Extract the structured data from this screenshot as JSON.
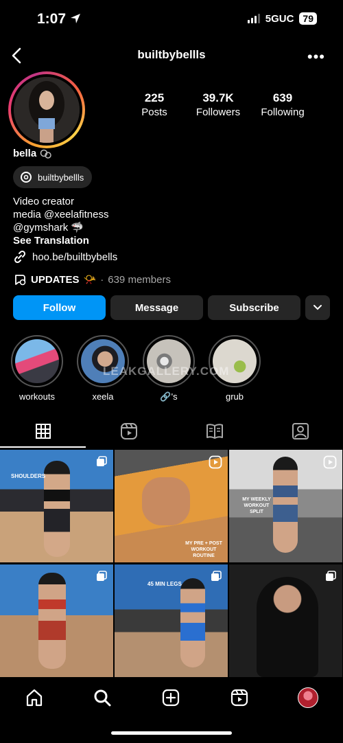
{
  "status_bar": {
    "time": "1:07",
    "network": "5GUC",
    "battery": "79"
  },
  "header": {
    "username": "builtbybellls"
  },
  "profile": {
    "stats": [
      {
        "value": "225",
        "label": "Posts"
      },
      {
        "value": "39.7K",
        "label": "Followers"
      },
      {
        "value": "639",
        "label": "Following"
      }
    ],
    "display_name": "bella",
    "threads_handle": "builtbybellls",
    "bio_lines": [
      "Video creator",
      "media @xeelafitness",
      "@gymshark 🦈"
    ],
    "see_translation": "See Translation",
    "link": "hoo.be/builtbybells",
    "channel": {
      "name": "UPDATES",
      "emoji": "📯",
      "separator": "·",
      "members": "639 members"
    }
  },
  "buttons": {
    "follow": "Follow",
    "message": "Message",
    "subscribe": "Subscribe"
  },
  "highlights": [
    {
      "label": "workouts"
    },
    {
      "label": "xeela"
    },
    {
      "label": "🔗's"
    },
    {
      "label": "grub"
    }
  ],
  "watermark": "LEAKGALLERY.COM",
  "posts": [
    {
      "overlay": "SHOULDERS",
      "type": "carousel"
    },
    {
      "overlay": "MY PRE + POST WORKOUT ROUTINE",
      "type": "reel"
    },
    {
      "overlay": "MY WEEKLY WORKOUT SPLIT",
      "type": "reel"
    },
    {
      "overlay": "",
      "type": "carousel"
    },
    {
      "overlay": "45 MIN LEGS",
      "type": "carousel"
    },
    {
      "overlay": "",
      "type": "carousel"
    }
  ],
  "colors": {
    "follow": "#0095f6",
    "button_bg": "#262626",
    "background": "#000000"
  }
}
